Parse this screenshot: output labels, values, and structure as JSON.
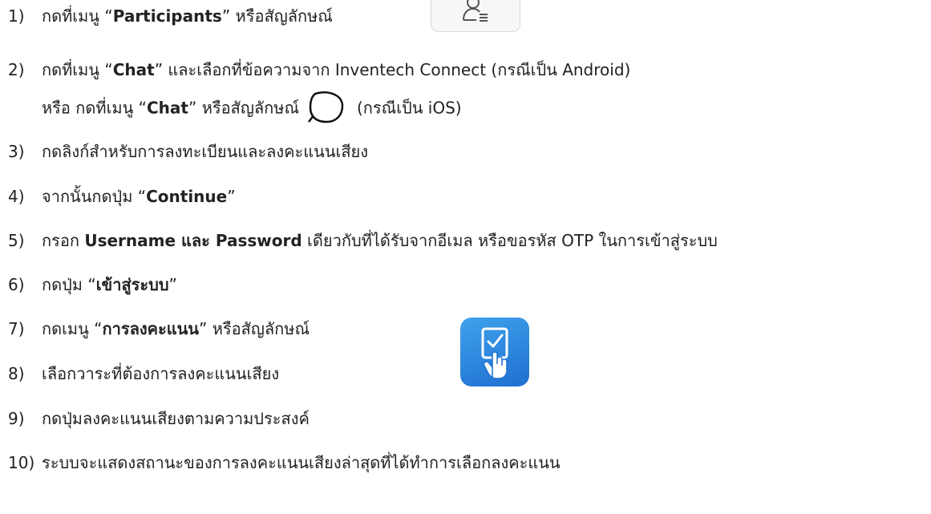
{
  "steps": [
    {
      "num": "1)",
      "pre": "กดที่เมนู “",
      "bold": "Participants",
      "post": "” หรือสัญลักษณ์",
      "icon": "participants-icon"
    },
    {
      "num": "2)",
      "pre": "กดที่เมนู “",
      "bold": "Chat",
      "post": "” และเลือกที่ข้อความจาก Inventech Connect (กรณีเป็น Android)",
      "cont_pre": "หรือ กดที่เมนู “",
      "cont_bold": "Chat",
      "cont_mid": "” หรือสัญลักษณ์",
      "cont_post": "(กรณีเป็น iOS)",
      "icon": "chat-bubble-icon"
    },
    {
      "num": "3)",
      "text": "กดลิงก์สำหรับการลงทะเบียนและลงคะแนนเสียง"
    },
    {
      "num": "4)",
      "pre": "จากนั้นกดปุ่ม “",
      "bold": "Continue",
      "post": "”"
    },
    {
      "num": "5)",
      "pre": "กรอก ",
      "bold1": "Username และ",
      "mid": " Password",
      "post": " เดียวกับที่ได้รับจากอีเมล หรือขอรหัส OTP ในการเข้าสู่ระบบ"
    },
    {
      "num": "6)",
      "pre": "กดปุ่ม “",
      "bold": "เข้าสู่ระบบ",
      "post": "”"
    },
    {
      "num": "7)",
      "pre": "กดเมนู “",
      "bold": "การลงคะแนน",
      "post": "” หรือสัญลักษณ์",
      "icon": "vote-hand-icon"
    },
    {
      "num": "8)",
      "text": "เลือกวาระที่ต้องการลงคะแนนเสียง"
    },
    {
      "num": "9)",
      "text": "กดปุ่มลงคะแนนเสียงตามความประสงค์"
    },
    {
      "num": "10)",
      "text": "ระบบจะแสดงสถานะของการลงคะแนนเสียงล่าสุดที่ได้ทำการเลือกลงคะแนน"
    }
  ],
  "colors": {
    "text": "#222222",
    "vote_icon_top": "#3fa2ec",
    "vote_icon_bottom": "#1f6fd0"
  }
}
